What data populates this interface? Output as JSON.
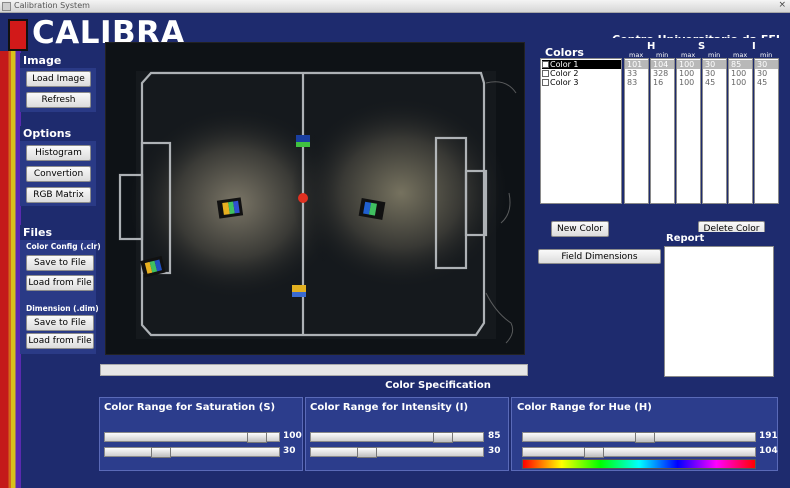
{
  "window": {
    "title": "Calibration System",
    "close_glyph": "×"
  },
  "header": {
    "logo": "CALIBRA",
    "organization": "Centro Universitario da FEI"
  },
  "image_panel": {
    "title": "Image",
    "load_image": "Load Image",
    "refresh": "Refresh"
  },
  "options_panel": {
    "title": "Options",
    "histogram": "Histogram",
    "convertion": "Convertion",
    "rgb_matrix": "RGB Matrix"
  },
  "files_panel": {
    "title": "Files",
    "color_config_label": "Color Config (.clr)",
    "color_save": "Save to File",
    "color_load": "Load from File",
    "dimension_label": "Dimension (.dim)",
    "dim_save": "Save to File",
    "dim_load": "Load from File"
  },
  "colors_panel": {
    "title": "Colors",
    "h": "H",
    "s": "S",
    "i": "I",
    "max": "max",
    "min": "min",
    "rows": [
      {
        "name": "Color 1",
        "values": [
          "101",
          "104",
          "100",
          "30",
          "85",
          "30"
        ],
        "selected": true
      },
      {
        "name": "Color 2",
        "values": [
          "33",
          "328",
          "100",
          "30",
          "100",
          "30"
        ],
        "selected": false
      },
      {
        "name": "Color 3",
        "values": [
          "83",
          "16",
          "100",
          "45",
          "100",
          "45"
        ],
        "selected": false
      }
    ],
    "new_color": "New Color",
    "delete_color": "Delete Color"
  },
  "field_dimensions": "Field Dimensions",
  "report": {
    "title": "Report"
  },
  "spec": {
    "title": "Color Specification",
    "saturation": {
      "title": "Color Range for Saturation (S)",
      "max": "100",
      "min": "30",
      "max_frac": 0.92,
      "min_frac": 0.3
    },
    "intensity": {
      "title": "Color Range for Intensity (I)",
      "max": "85",
      "min": "30",
      "max_frac": 0.8,
      "min_frac": 0.3
    },
    "hue": {
      "title": "Color Range for Hue (H)",
      "max": "191",
      "min": "104",
      "max_frac": 0.53,
      "min_frac": 0.29
    }
  },
  "colors": {
    "navy": "#1e2b6e",
    "panel": "#2a3a86",
    "logo_red": "#d21919"
  }
}
